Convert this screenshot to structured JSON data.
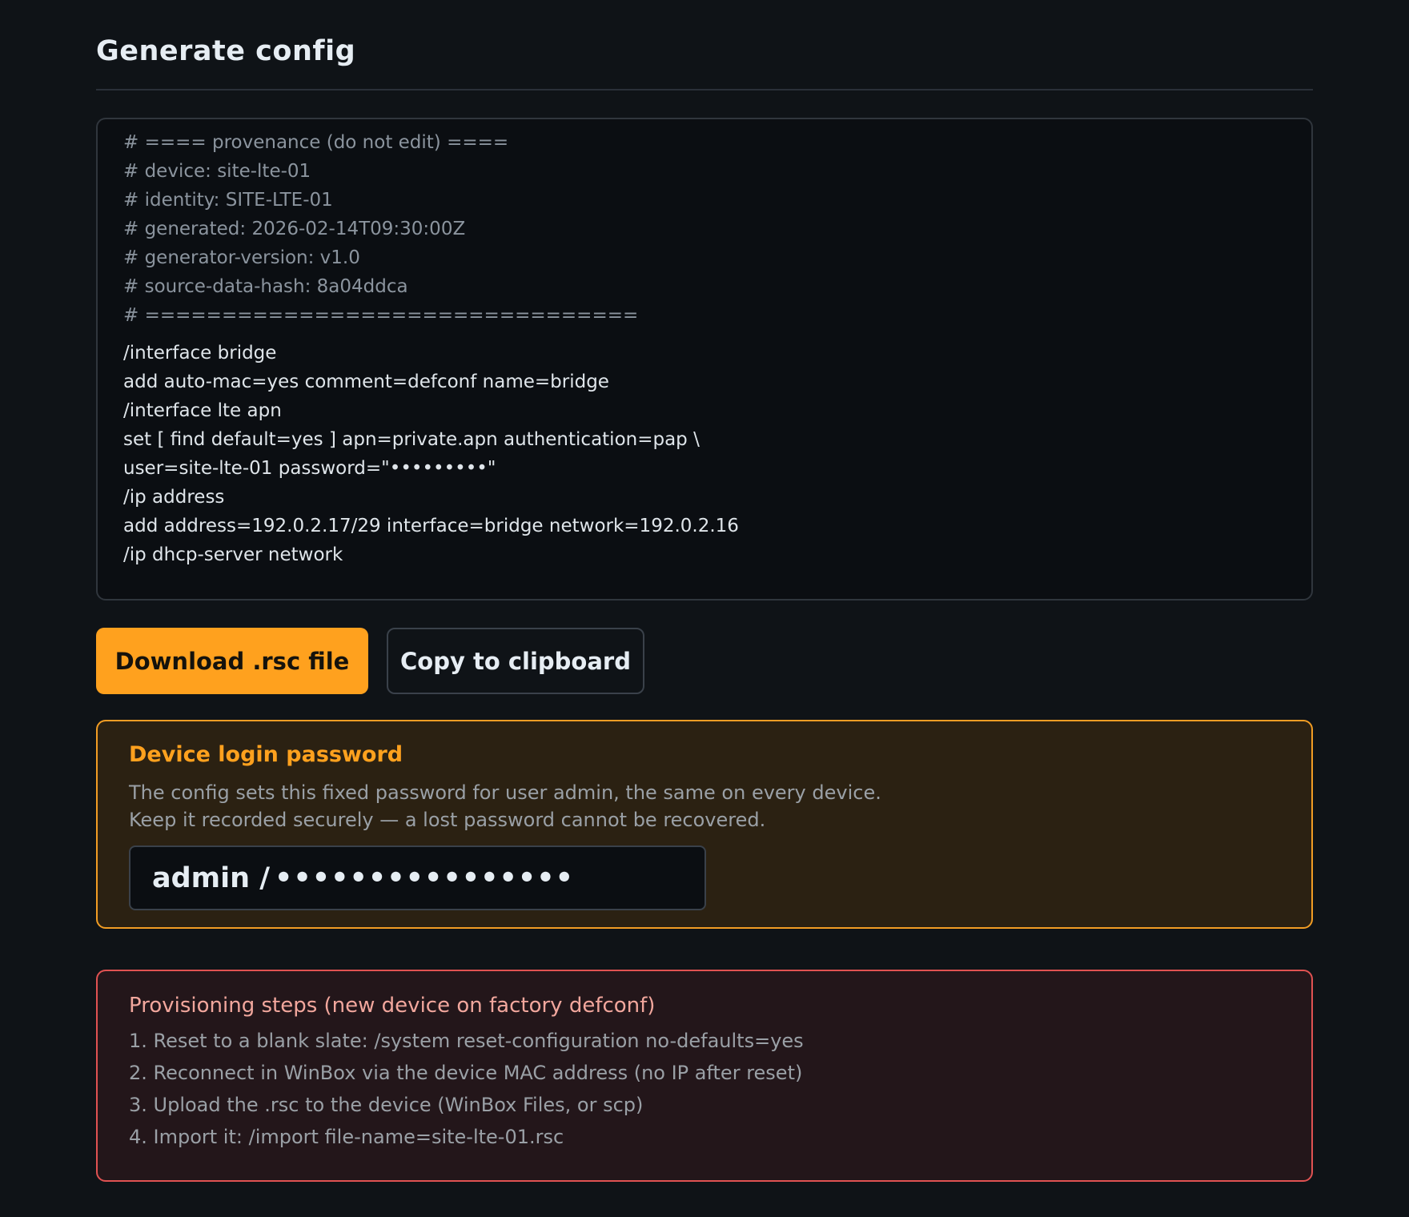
{
  "page": {
    "title": "Generate config"
  },
  "config": {
    "lines": [
      {
        "text": "# ==== provenance (do not edit) ====",
        "kind": "comment"
      },
      {
        "text": "# device: site-lte-01",
        "kind": "comment"
      },
      {
        "text": "# identity: SITE-LTE-01",
        "kind": "comment"
      },
      {
        "text": "# generated: 2026-02-14T09:30:00Z",
        "kind": "comment"
      },
      {
        "text": "# generator-version: v1.0",
        "kind": "comment"
      },
      {
        "text": "# source-data-hash: 8a04ddca",
        "kind": "comment"
      },
      {
        "text": "# ================================",
        "kind": "comment"
      },
      {
        "text": "/interface bridge",
        "kind": "cmd"
      },
      {
        "text": "add auto-mac=yes comment=defconf name=bridge",
        "kind": "cmd"
      },
      {
        "text": "/interface lte apn",
        "kind": "cmd"
      },
      {
        "text": "set [ find default=yes ] apn=private.apn authentication=pap \\",
        "kind": "cmd"
      },
      {
        "text": "user=site-lte-01 password=\"•••••••••\"",
        "kind": "cmd"
      },
      {
        "text": "/ip address",
        "kind": "cmd"
      },
      {
        "text": "add address=192.0.2.17/29 interface=bridge network=192.0.2.16",
        "kind": "cmd"
      },
      {
        "text": "/ip dhcp-server network",
        "kind": "cmd"
      }
    ]
  },
  "actions": {
    "download_label": "Download .rsc file",
    "copy_label": "Copy to clipboard"
  },
  "password_panel": {
    "heading": "Device login password",
    "line1": "The config sets this fixed password for user admin, the same on every device.",
    "line2": "Keep it recorded securely — a lost password cannot be recovered.",
    "username": "admin /",
    "masked_password": "••••••••••••••••"
  },
  "steps_panel": {
    "heading": "Provisioning steps (new device on factory defconf)",
    "steps": [
      "1. Reset to a blank slate: /system reset-configuration no-defaults=yes",
      "2. Reconnect in WinBox via the device MAC address (no IP after reset)",
      "3. Upload the .rsc to the device (WinBox Files, or scp)",
      "4. Import it: /import file-name=site-lte-01.rsc"
    ]
  },
  "colors": {
    "background": "#0f1317",
    "accent": "#ffa11e",
    "warning_border": "#f29d24",
    "danger_border": "#e05252"
  }
}
